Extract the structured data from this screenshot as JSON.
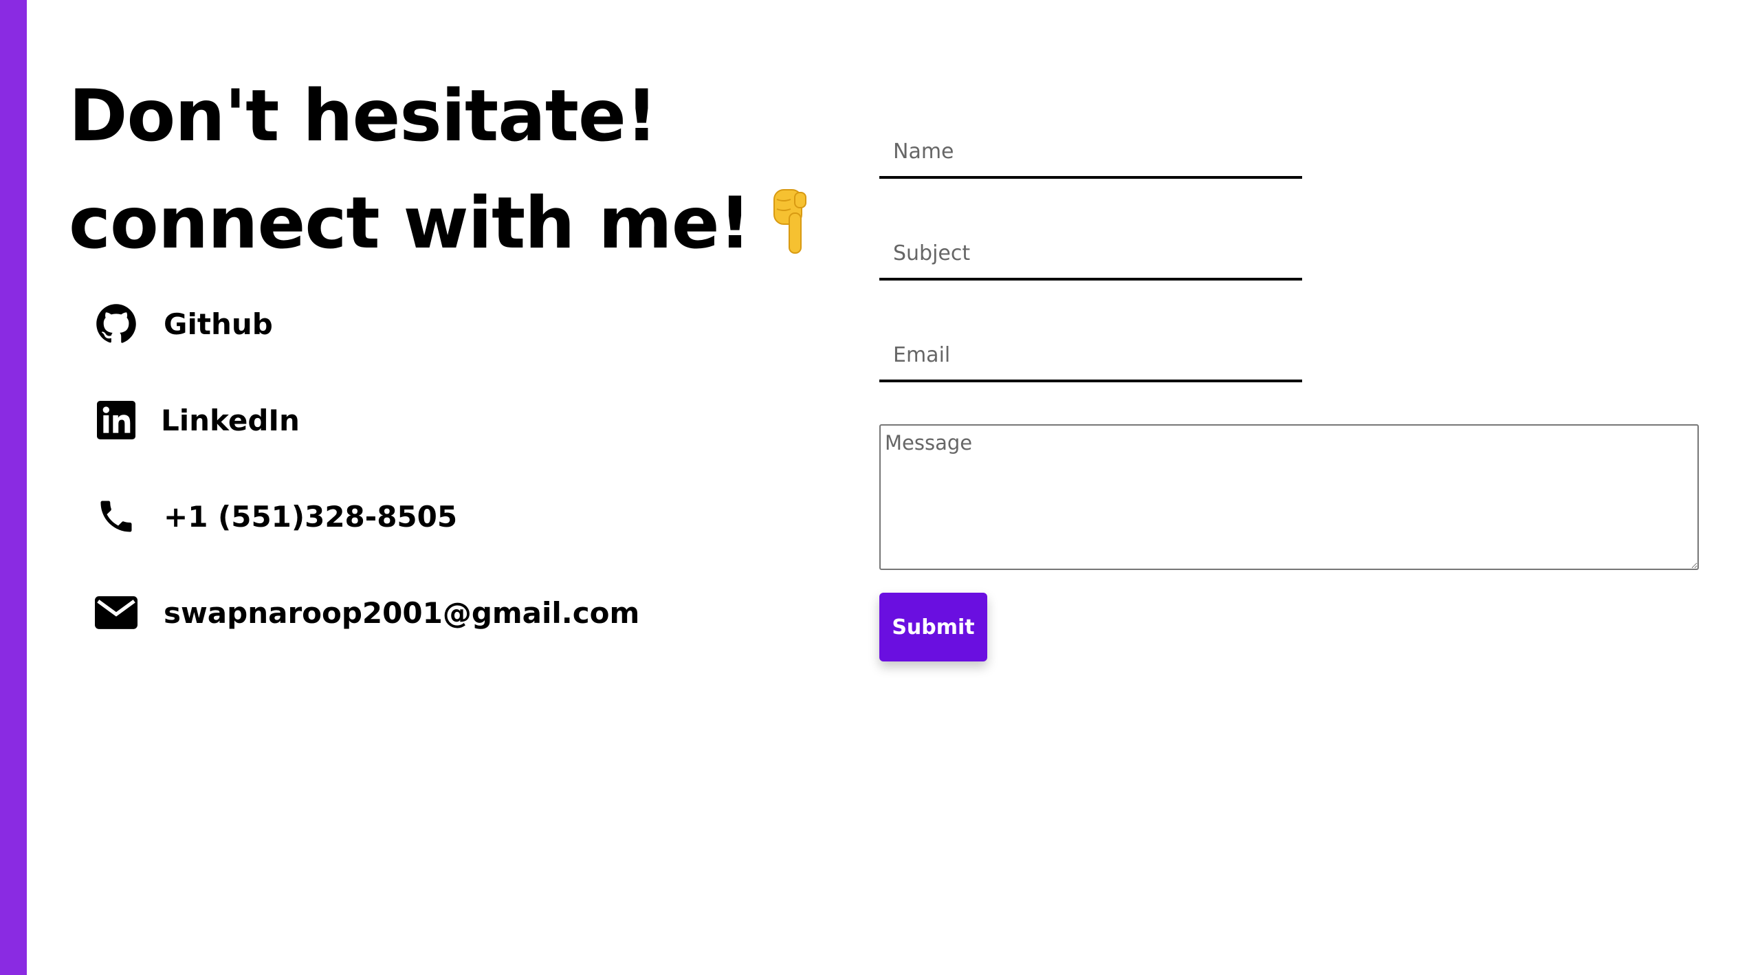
{
  "theme": {
    "accent": "#8a2be2",
    "button": "#6a0fe0"
  },
  "heading": {
    "line1": "Don't hesitate!",
    "line2": "connect with me!",
    "emoji": "pointing-down-hand"
  },
  "contacts": [
    {
      "icon": "github-icon",
      "label": "Github"
    },
    {
      "icon": "linkedin-icon",
      "label": "LinkedIn"
    },
    {
      "icon": "phone-icon",
      "label": "+1 (551)328-8505"
    },
    {
      "icon": "envelope-icon",
      "label": "swapnaroop2001@gmail.com"
    }
  ],
  "form": {
    "name_placeholder": "Name",
    "subject_placeholder": "Subject",
    "email_placeholder": "Email",
    "message_placeholder": "Message",
    "submit_label": "Submit"
  }
}
